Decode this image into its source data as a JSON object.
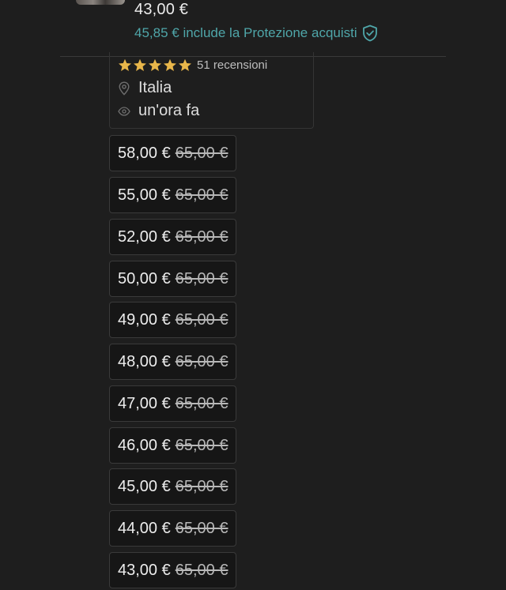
{
  "listing": {
    "price": "43,00 €",
    "protection_text": "45,85 € include la Protezione acquisti"
  },
  "seller": {
    "rating_stars": 5,
    "reviews": "51 recensioni",
    "location": "Italia",
    "last_seen": "un'ora fa"
  },
  "offers": [
    {
      "price": "58,00 €",
      "original": "65,00 €"
    },
    {
      "price": "55,00 €",
      "original": "65,00 €"
    },
    {
      "price": "52,00 €",
      "original": "65,00 €"
    },
    {
      "price": "50,00 €",
      "original": "65,00 €"
    },
    {
      "price": "49,00 €",
      "original": "65,00 €"
    },
    {
      "price": "48,00 €",
      "original": "65,00 €"
    },
    {
      "price": "47,00 €",
      "original": "65,00 €"
    },
    {
      "price": "46,00 €",
      "original": "65,00 €"
    },
    {
      "price": "45,00 €",
      "original": "65,00 €"
    },
    {
      "price": "44,00 €",
      "original": "65,00 €"
    },
    {
      "price": "43,00 €",
      "original": "65,00 €"
    }
  ],
  "colors": {
    "background": "#1e1e1e",
    "accent_teal": "#4fa6a9",
    "star_gold": "#e8b64a"
  },
  "icons": {
    "protection": "shield-check-icon",
    "location": "location-pin-icon",
    "last_seen": "eye-icon",
    "rating": "star-icon"
  }
}
